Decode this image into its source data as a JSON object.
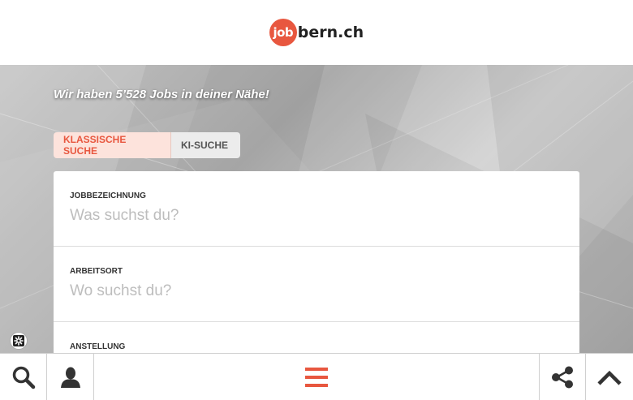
{
  "header": {
    "logo_badge": "job",
    "logo_text": "bern.ch"
  },
  "hero": {
    "headline": "Wir haben 5’528 Jobs in deiner Nähe!"
  },
  "tabs": [
    {
      "label": "KLASSISCHE SUCHE"
    },
    {
      "label": "KI-SUCHE"
    }
  ],
  "search": {
    "job_label": "JOBBEZEICHNUNG",
    "job_placeholder": "Was suchst du?",
    "location_label": "ARBEITSORT",
    "location_placeholder": "Wo suchst du?",
    "employment_label": "ANSTELLUNG"
  },
  "colors": {
    "accent": "#e8573f",
    "tab_active_bg": "#fde3dc"
  },
  "bottom_bar": {
    "icons": [
      "search-icon",
      "user-icon",
      "menu-icon",
      "share-icon",
      "chevron-up-icon"
    ]
  }
}
